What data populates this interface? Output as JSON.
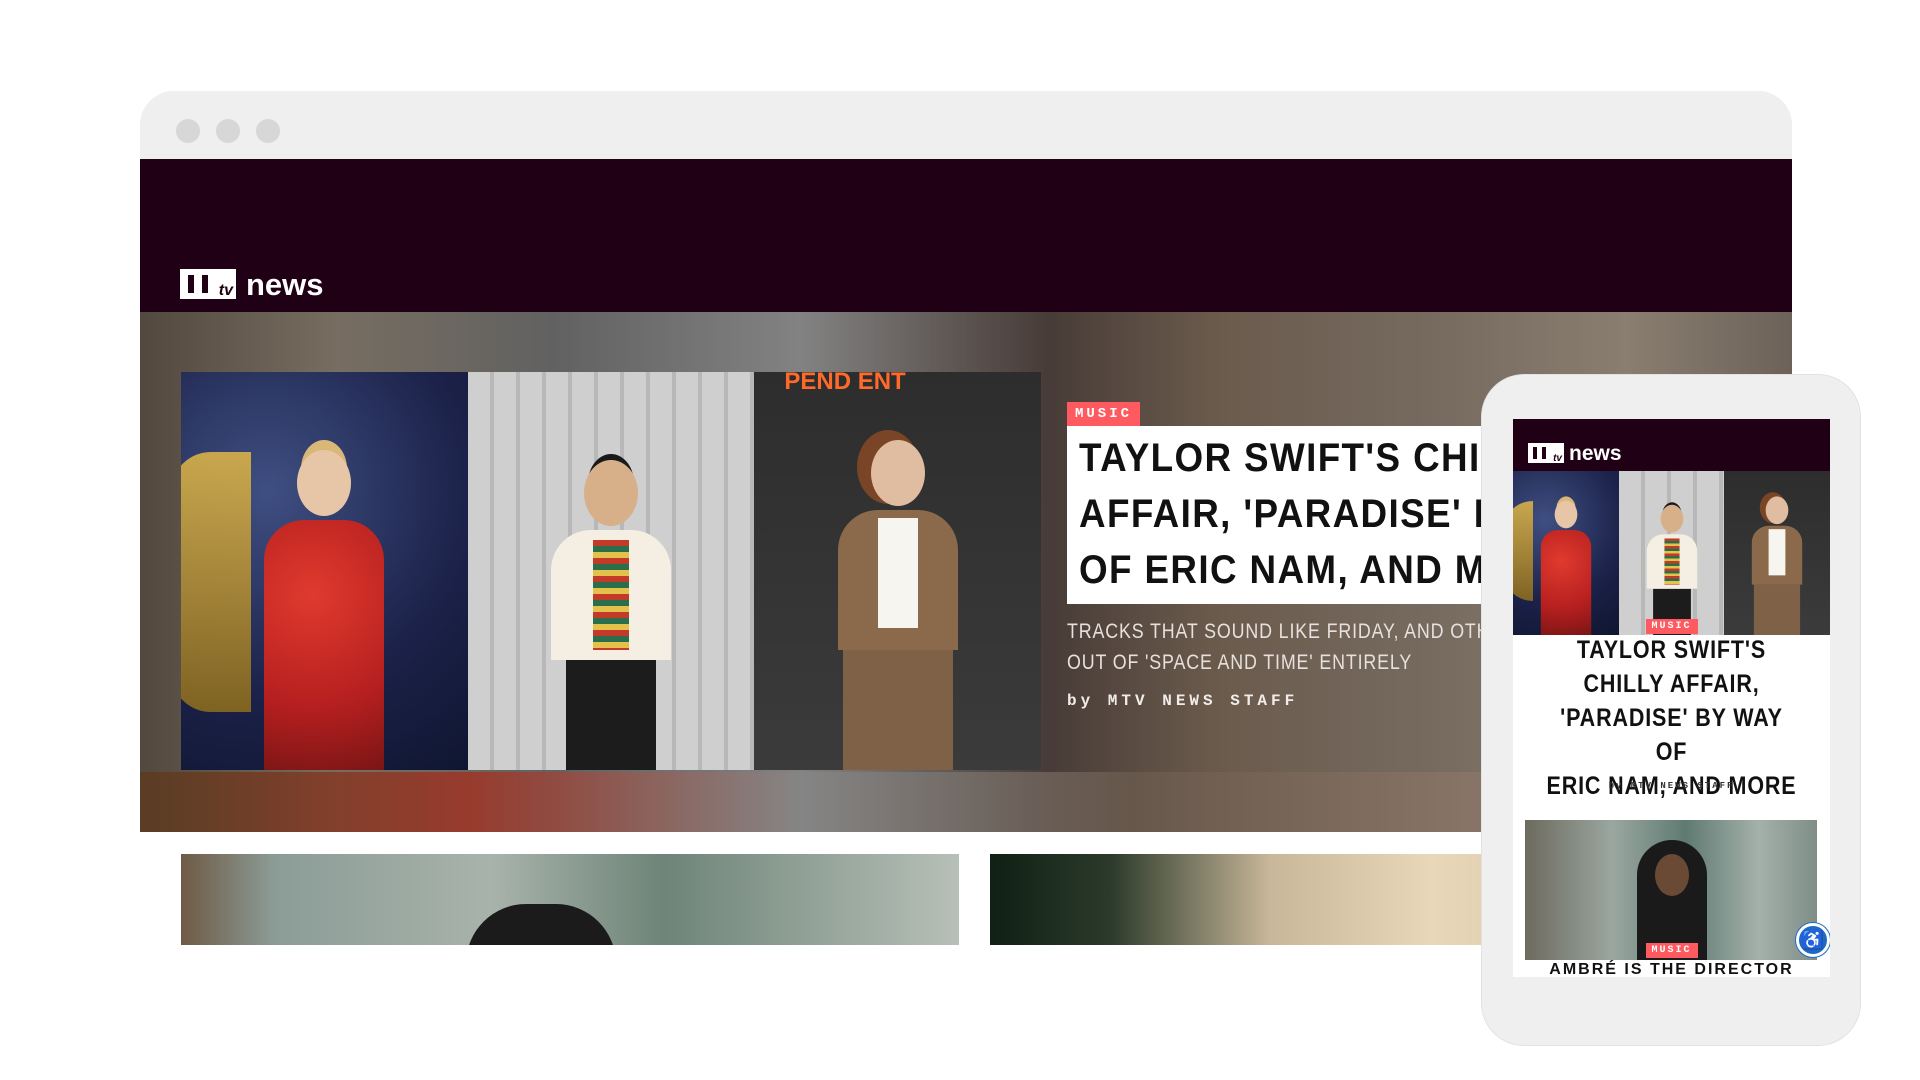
{
  "site": {
    "logo_text": "news",
    "logo_alt": "MTV",
    "brand_color": "#1f0015",
    "accent_color": "#ff5a5f"
  },
  "hero": {
    "tag": "MUSIC",
    "headline_lines": [
      "TAYLOR SWIFT'S CHI",
      "AFFAIR, 'PARADISE' B",
      "OF ERIC NAM, AND M"
    ],
    "dek_lines": [
      "TRACKS THAT SOUND LIKE FRIDAY, AND OTHE",
      "OUT OF 'SPACE AND TIME' ENTIRELY"
    ],
    "byline": "by MTV NEWS STAFF",
    "panel_text": "PEND ENT"
  },
  "mobile": {
    "logo_text": "news",
    "tag": "MUSIC",
    "headline_lines": [
      "TAYLOR SWIFT'S",
      "CHILLY AFFAIR,",
      "'PARADISE' BY WAY OF",
      "ERIC NAM, AND MORE"
    ],
    "byline": "by MTV NEWS STAFF",
    "card_tag": "MUSIC",
    "card_title": "AMBRÉ IS THE DIRECTOR",
    "accessibility_icon": "accessibility-icon"
  }
}
